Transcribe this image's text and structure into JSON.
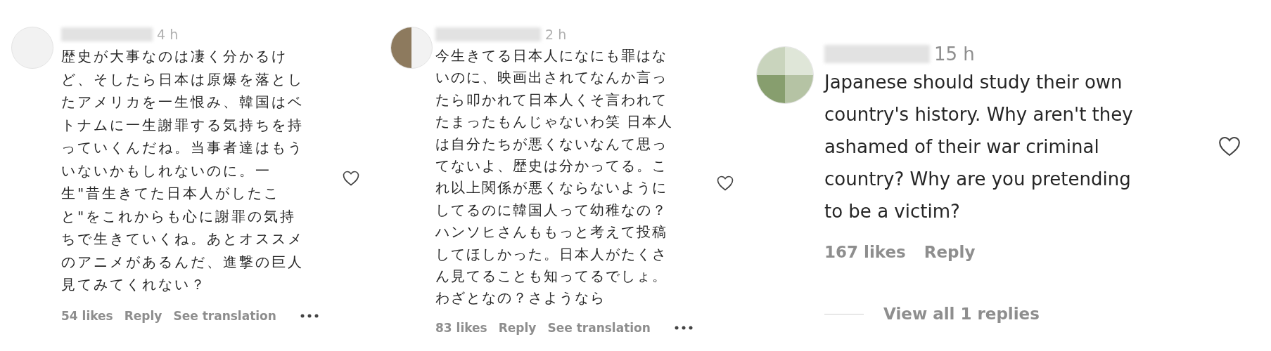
{
  "comments": [
    {
      "time": "4 h",
      "lines": [
        "歴史が大事なのは凄く分かるけ",
        "ど、そしたら日本は原爆を落とし",
        "たアメリカを一生恨み、韓国はベ",
        "トナムに一生謝罪する気持ちを持",
        "っていくんだね。当事者達はもう",
        "いないかもしれないのに。一",
        "生\"昔生きてた日本人がしたこ",
        "と\"をこれからも心に謝罪の気持",
        "ちで生きていくね。あとオススメ",
        "のアニメがあるんだ、進撃の巨人",
        "見てみてくれない？"
      ],
      "likes": "54 likes",
      "reply": "Reply",
      "translate": "See translation"
    },
    {
      "time": "2 h",
      "lines": [
        "今生きてる日本人になにも罪はな",
        "いのに、映画出されてなんか言っ",
        "たら叩かれて日本人くそ言われて",
        "たまったもんじゃないわ笑 日本人",
        "は自分たちが悪くないなんて思っ",
        "てないよ、歴史は分かってる。こ",
        "れ以上関係が悪くならないように",
        "してるのに韓国人って幼稚なの？",
        "ハンソヒさんももっと考えて投稿",
        "してほしかった。日本人がたくさ",
        "ん見てることも知ってるでしょ。",
        "わざとなの？さようなら"
      ],
      "likes": "83 likes",
      "reply": "Reply",
      "translate": "See translation"
    },
    {
      "time": "15 h",
      "lines": [
        "Japanese should study their own",
        "country's history. Why aren't they",
        "ashamed of their war criminal",
        "country? Why are you pretending",
        "to be a victim?"
      ],
      "likes": "167 likes",
      "reply": "Reply",
      "view_replies": "View all 1 replies"
    }
  ]
}
